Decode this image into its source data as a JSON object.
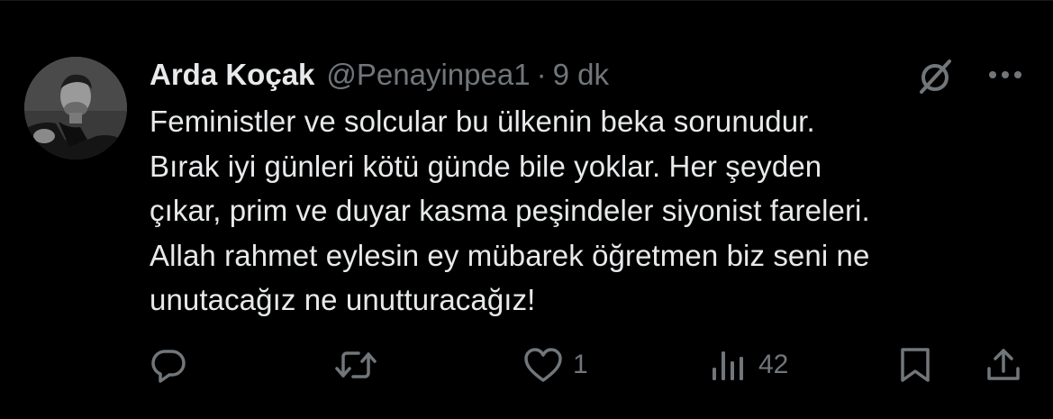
{
  "tweet": {
    "author": {
      "display_name": "Arda Koçak",
      "handle": "@Penayinpea1",
      "avatar": "profile-photo"
    },
    "separator": "·",
    "time": "9 dk",
    "text_lines": [
      "Feministler ve solcular bu ülkenin beka sorunudur.",
      "Bırak iyi günleri kötü günde bile yoklar. Her şeyden",
      "çıkar, prim ve duyar kasma peşindeler siyonist fareleri.",
      "Allah rahmet eylesin ey mübarek öğretmen biz seni ne",
      "unutacağız ne unutturacağız!"
    ],
    "actions": {
      "reply": {
        "icon": "reply-icon",
        "count": ""
      },
      "retweet": {
        "icon": "retweet-icon",
        "count": ""
      },
      "like": {
        "icon": "heart-icon",
        "count": "1"
      },
      "views": {
        "icon": "views-icon",
        "count": "42"
      },
      "bookmark": {
        "icon": "bookmark-icon"
      },
      "share": {
        "icon": "share-icon"
      }
    },
    "header_icons": [
      "grok-icon",
      "more-icon"
    ]
  },
  "colors": {
    "background": "#000000",
    "text_primary": "#e7e9ea",
    "text_secondary": "#71767b"
  }
}
